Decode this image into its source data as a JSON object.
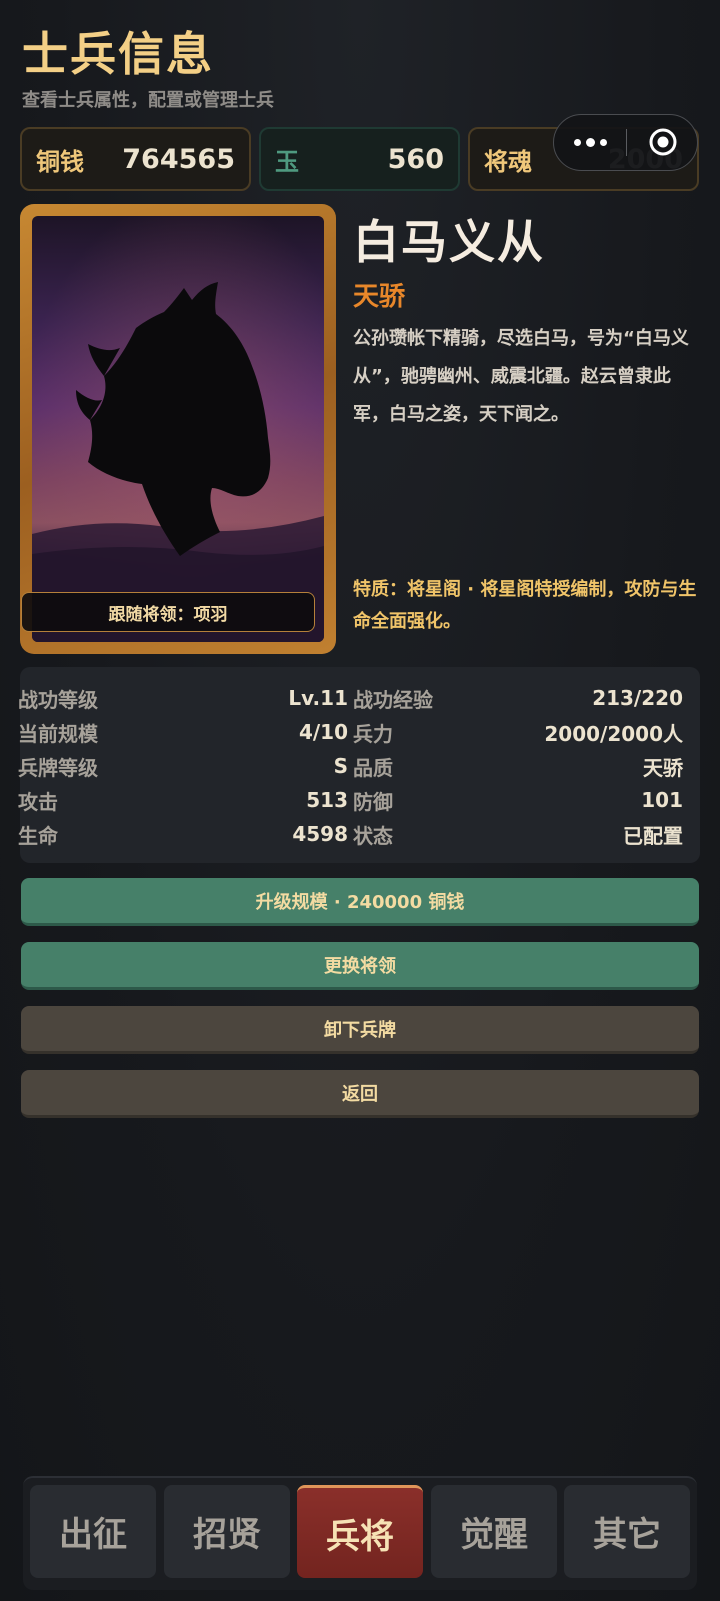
{
  "header": {
    "title": "士兵信息",
    "subtitle": "查看士兵属性，配置或管理士兵"
  },
  "resources": [
    {
      "label": "铜钱",
      "value": "764565",
      "color": "#efc77a"
    },
    {
      "label": "玉",
      "value": "560",
      "color": "#4f9a80"
    },
    {
      "label": "将魂",
      "value": "2000",
      "color": "#efc77a"
    }
  ],
  "capsule": {
    "more_icon": "more-dots-icon",
    "close_icon": "target-circle-icon"
  },
  "unit": {
    "name": "白马义从",
    "quality": "天骄",
    "description": "公孙瓒帐下精骑，尽选白马，号为“白马义从”，驰骋幽州、威震北疆。赵云曾隶此军，白马之姿，天下闻之。",
    "trait": "特质：将星阁 · 将星阁特授编制，攻防与生命全面强化。",
    "leader_label": "跟随将领：项羽",
    "portrait_icon": "horse-head-silhouette"
  },
  "stats": {
    "left": [
      {
        "label": "战功等级",
        "value": "Lv.11"
      },
      {
        "label": "当前规模",
        "value": "4/10"
      },
      {
        "label": "兵牌等级",
        "value": "S"
      },
      {
        "label": "攻击",
        "value": "513"
      },
      {
        "label": "生命",
        "value": "4598"
      }
    ],
    "right": [
      {
        "label": "战功经验",
        "value": "213/220"
      },
      {
        "label": "兵力",
        "value": "2000/2000人"
      },
      {
        "label": "品质",
        "value": "天骄"
      },
      {
        "label": "防御",
        "value": "101"
      },
      {
        "label": "状态",
        "value": "已配置"
      }
    ]
  },
  "actions": {
    "upgrade": "升级规模 · 240000 铜钱",
    "change_leader": "更换将领",
    "unequip": "卸下兵牌",
    "back": "返回"
  },
  "nav": {
    "tabs": [
      "出征",
      "招贤",
      "兵将",
      "觉醒",
      "其它"
    ],
    "active": "兵将"
  },
  "colors": {
    "accent_gold": "#f3cf86",
    "quality_orange": "#e8872a",
    "button_green": "#468069",
    "button_gray": "#4c463e",
    "nav_active_red": "#8a2f2a"
  }
}
